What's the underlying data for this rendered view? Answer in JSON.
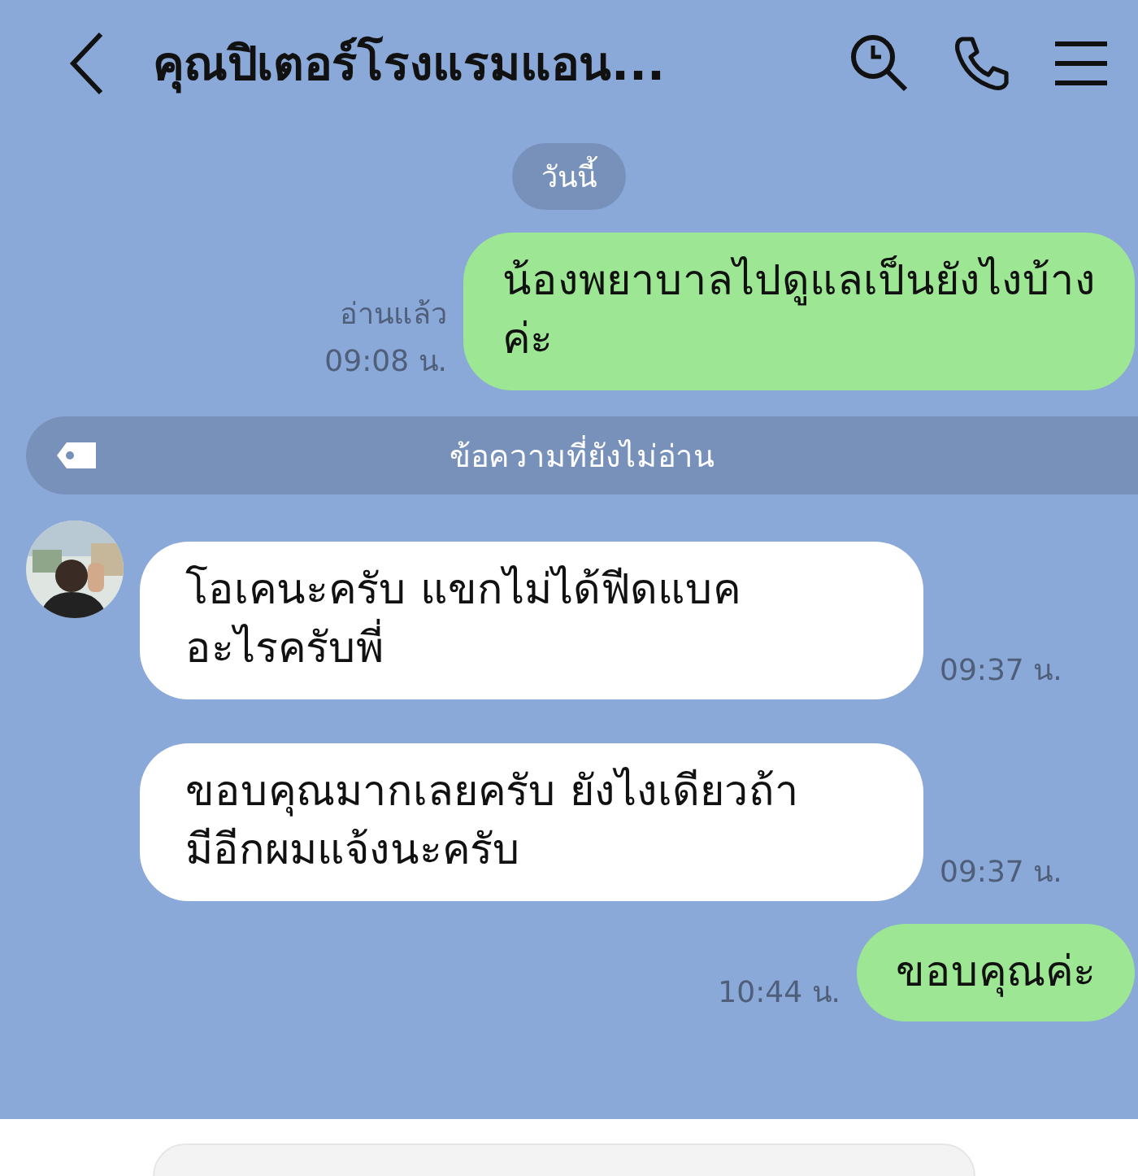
{
  "header": {
    "title": "คุณปิเตอร์โรงแรมแอน..."
  },
  "messages": [
    {
      "kind": "date",
      "text": "วันนี้"
    },
    {
      "kind": "outgoing",
      "lines": [
        "น้องพยาบาลไปดูแลเป็นยังไงบ้าง",
        "ค่ะ"
      ],
      "read_label": "อ่านแล้ว",
      "time": "09:08 น."
    },
    {
      "kind": "unread_divider",
      "text": "ข้อความที่ยังไม่อ่าน"
    },
    {
      "kind": "incoming",
      "avatar": true,
      "lines": [
        "โอเคนะครับ แขกไม่ได้ฟีดแบค",
        "อะไรครับพี่"
      ],
      "time": "09:37 น."
    },
    {
      "kind": "incoming",
      "avatar": false,
      "lines": [
        "ขอบคุณมากเลยครับ ยังไงเดียวถ้า",
        "มีอีกผมแจ้งนะครับ"
      ],
      "time": "09:37 น."
    },
    {
      "kind": "outgoing",
      "lines": [
        "ขอบคุณค่ะ"
      ],
      "time": "10:44 น."
    }
  ]
}
